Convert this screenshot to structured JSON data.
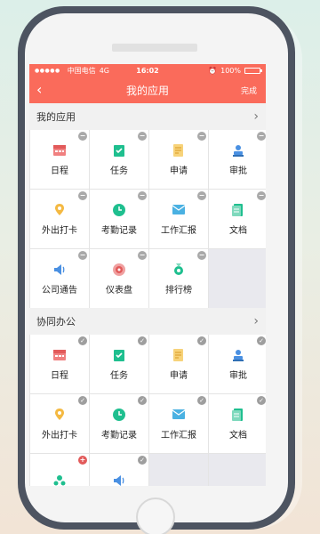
{
  "status": {
    "carrier": "中国电信",
    "network": "4G",
    "time": "16:02",
    "battery": "100%"
  },
  "nav": {
    "back_icon": "back-chevron-icon",
    "title": "我的应用",
    "done": "完成"
  },
  "sections": [
    {
      "title": "我的应用",
      "items": [
        {
          "label": "日程",
          "icon": "calendar-icon",
          "badge": "remove"
        },
        {
          "label": "任务",
          "icon": "task-icon",
          "badge": "remove"
        },
        {
          "label": "申请",
          "icon": "apply-icon",
          "badge": "remove"
        },
        {
          "label": "审批",
          "icon": "approve-icon",
          "badge": "remove"
        },
        {
          "label": "外出打卡",
          "icon": "checkin-icon",
          "badge": "remove"
        },
        {
          "label": "考勤记录",
          "icon": "attendance-icon",
          "badge": "remove"
        },
        {
          "label": "工作汇报",
          "icon": "report-icon",
          "badge": "remove"
        },
        {
          "label": "文档",
          "icon": "document-icon",
          "badge": "remove"
        },
        {
          "label": "公司通告",
          "icon": "announcement-icon",
          "badge": "remove"
        },
        {
          "label": "仪表盘",
          "icon": "dashboard-icon",
          "badge": "remove"
        },
        {
          "label": "排行榜",
          "icon": "ranking-icon",
          "badge": "remove"
        }
      ]
    },
    {
      "title": "协同办公",
      "items": [
        {
          "label": "日程",
          "icon": "calendar-icon",
          "badge": "check"
        },
        {
          "label": "任务",
          "icon": "task-icon",
          "badge": "check"
        },
        {
          "label": "申请",
          "icon": "apply-icon",
          "badge": "check"
        },
        {
          "label": "审批",
          "icon": "approve-icon",
          "badge": "check"
        },
        {
          "label": "外出打卡",
          "icon": "checkin-icon",
          "badge": "check"
        },
        {
          "label": "考勤记录",
          "icon": "attendance-icon",
          "badge": "check"
        },
        {
          "label": "工作汇报",
          "icon": "report-icon",
          "badge": "check"
        },
        {
          "label": "文档",
          "icon": "document-icon",
          "badge": "check"
        },
        {
          "label": "",
          "icon": "people-icon",
          "badge": "add"
        },
        {
          "label": "",
          "icon": "announcement-icon",
          "badge": "check"
        }
      ]
    }
  ],
  "colors": {
    "accent": "#fa6b5b",
    "green": "#1fbf8f",
    "yellow": "#f4b942",
    "blue": "#4a90e2"
  }
}
